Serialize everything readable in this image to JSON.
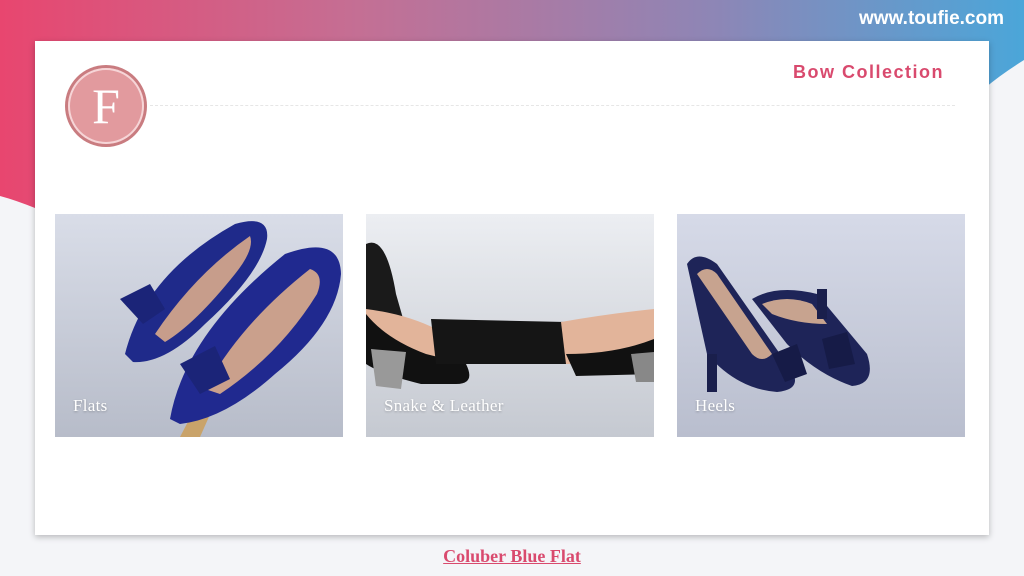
{
  "header": {
    "site_url": "www.toufie.com"
  },
  "brand": {
    "logo_letter": "F"
  },
  "card": {
    "title": "Bow Collection"
  },
  "tiles": [
    {
      "label": "Flats",
      "image": "blue-bow-flats"
    },
    {
      "label": "Snake & Leather",
      "image": "black-snake-heel-pumps"
    },
    {
      "label": "Heels",
      "image": "navy-bow-heels"
    }
  ],
  "footer": {
    "link_text": "Coluber Blue Flat"
  },
  "colors": {
    "accent": "#d94a6e",
    "gradient_start": "#e8466f",
    "gradient_end": "#4ba6d9",
    "logo": "#e29a9e"
  }
}
